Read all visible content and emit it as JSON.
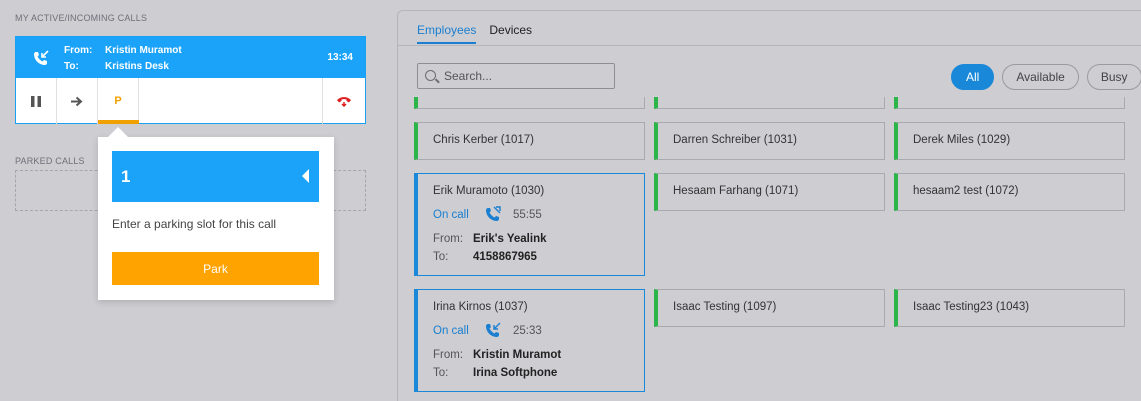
{
  "left": {
    "active_calls_title": "MY ACTIVE/INCOMING CALLS",
    "call": {
      "from_label": "From:",
      "from_value": "Kristin Muramot",
      "to_label": "To:",
      "to_value": "Kristins Desk",
      "time": "13:34",
      "actions": {
        "park_label": "P"
      }
    },
    "parked_title": "PARKED CALLS",
    "popover": {
      "slot_number": "1",
      "message": "Enter a parking slot for this call",
      "park_button": "Park"
    }
  },
  "right": {
    "tabs": [
      {
        "label": "Employees",
        "active": true
      },
      {
        "label": "Devices",
        "active": false
      }
    ],
    "search": {
      "placeholder": "Search..."
    },
    "filters": [
      {
        "label": "All",
        "active": true
      },
      {
        "label": "Available",
        "active": false
      },
      {
        "label": "Busy",
        "active": false
      }
    ],
    "cards": [
      {
        "name": "Chris Kerber (1017)"
      },
      {
        "name": "Darren Schreiber (1031)"
      },
      {
        "name": "Derek Miles (1029)"
      },
      {
        "name": "Erik Muramoto (1030)",
        "status": "On call",
        "duration": "55:55",
        "from_label": "From:",
        "from": "Erik's Yealink",
        "to_label": "To:",
        "to": "4158867965"
      },
      {
        "name": "Hesaam Farhang (1071)"
      },
      {
        "name": "hesaam2 test (1072)"
      },
      {
        "name": "Irina Kirnos (1037)",
        "status": "On call",
        "duration": "25:33",
        "from_label": "From:",
        "from": "Kristin Muramot",
        "to_label": "To:",
        "to": "Irina Softphone"
      },
      {
        "name": "Isaac Testing (1097)"
      },
      {
        "name": "Isaac Testing23 (1043)"
      }
    ]
  },
  "colors": {
    "accent_blue": "#1ba3f9",
    "park_orange": "#ffa300",
    "available_green": "#2bb54a",
    "hangup_red": "#e02020"
  }
}
